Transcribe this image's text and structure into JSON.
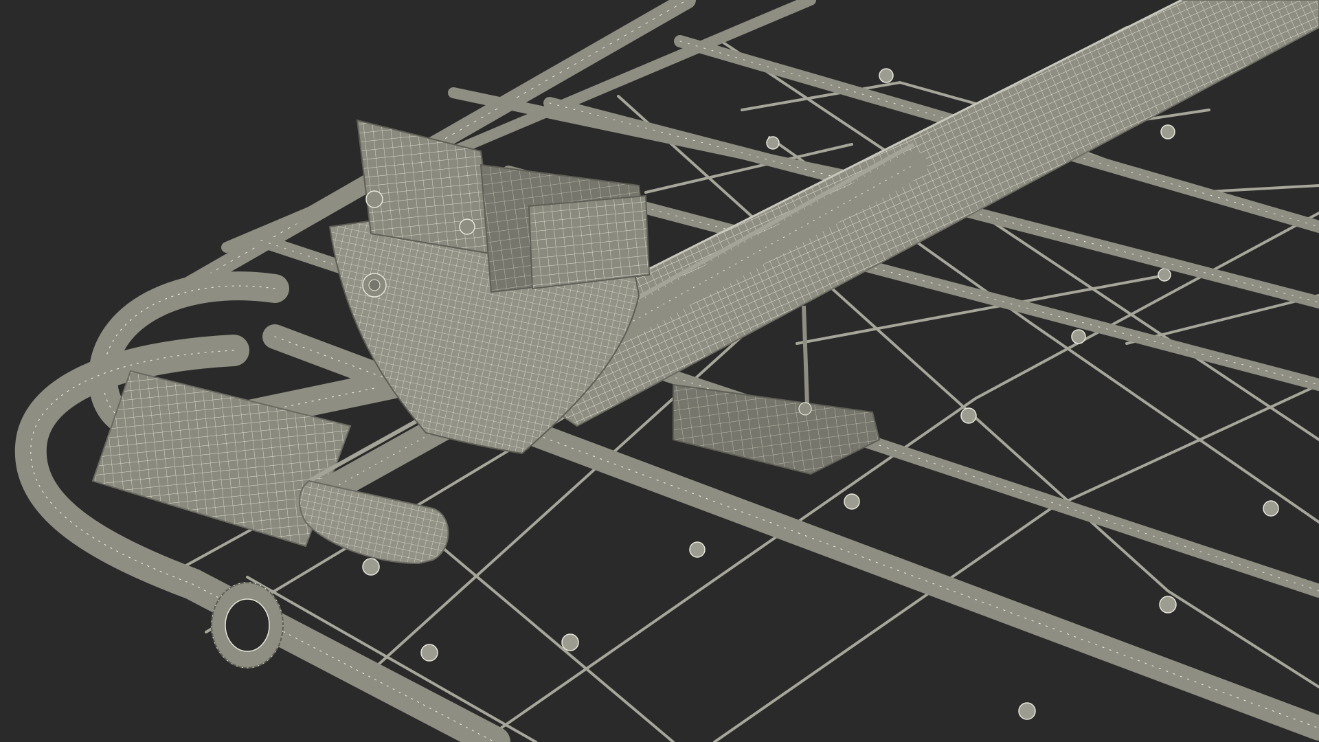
{
  "scene": {
    "subject": "wireframe-render",
    "colors": {
      "background": "#2a2a2a",
      "surface": "#8e8e82",
      "surface_light": "#a4a498",
      "surface_dark": "#707066",
      "wire": "#e6e6da",
      "net": "#a6a69a",
      "shadow": "#3a3a36"
    }
  }
}
